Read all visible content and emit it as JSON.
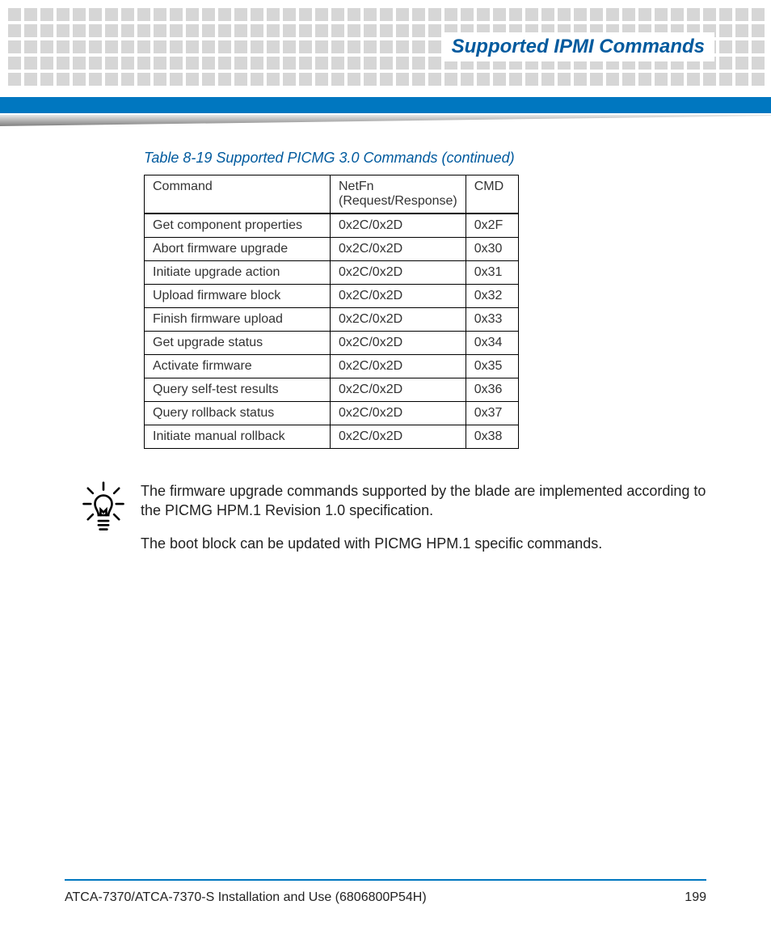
{
  "header": {
    "section_title": "Supported IPMI Commands"
  },
  "table": {
    "caption": "Table 8-19 Supported PICMG 3.0 Commands (continued)",
    "columns": {
      "command": "Command",
      "netfn": "NetFn (Request/Response)",
      "cmd": "CMD"
    },
    "rows": [
      {
        "command": "Get component properties",
        "netfn": "0x2C/0x2D",
        "cmd": "0x2F"
      },
      {
        "command": "Abort firmware upgrade",
        "netfn": "0x2C/0x2D",
        "cmd": "0x30"
      },
      {
        "command": "Initiate upgrade action",
        "netfn": "0x2C/0x2D",
        "cmd": "0x31"
      },
      {
        "command": "Upload firmware block",
        "netfn": "0x2C/0x2D",
        "cmd": "0x32"
      },
      {
        "command": "Finish firmware upload",
        "netfn": "0x2C/0x2D",
        "cmd": "0x33"
      },
      {
        "command": "Get upgrade status",
        "netfn": "0x2C/0x2D",
        "cmd": "0x34"
      },
      {
        "command": "Activate firmware",
        "netfn": "0x2C/0x2D",
        "cmd": "0x35"
      },
      {
        "command": "Query self-test results",
        "netfn": "0x2C/0x2D",
        "cmd": "0x36"
      },
      {
        "command": "Query rollback status",
        "netfn": "0x2C/0x2D",
        "cmd": "0x37"
      },
      {
        "command": "Initiate manual rollback",
        "netfn": "0x2C/0x2D",
        "cmd": "0x38"
      }
    ]
  },
  "note": {
    "p1": "The firmware upgrade commands supported by the blade are implemented according to the PICMG HPM.1 Revision 1.0 specification.",
    "p2": "The boot block can be updated with PICMG HPM.1 specific commands."
  },
  "footer": {
    "doc_title": "ATCA-7370/ATCA-7370-S Installation and Use (6806800P54H)",
    "page_number": "199"
  }
}
